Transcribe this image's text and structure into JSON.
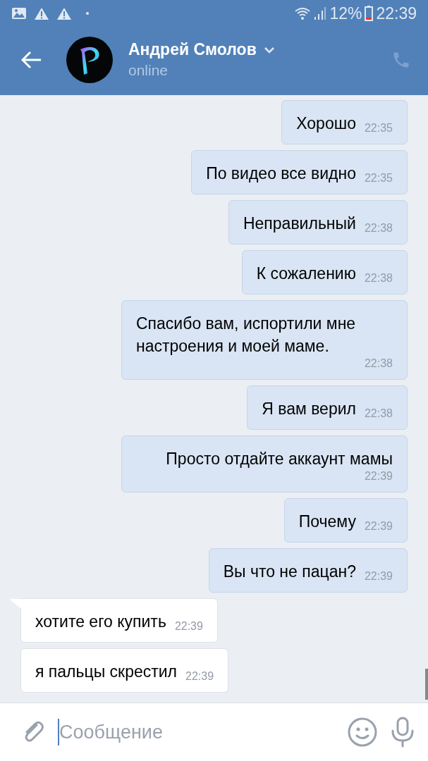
{
  "status_bar": {
    "battery": "12%",
    "time": "22:39"
  },
  "header": {
    "name": "Андрей Смолов",
    "status": "online"
  },
  "messages": [
    {
      "kind": "out",
      "text": "Хорошо",
      "time": "22:35"
    },
    {
      "kind": "out",
      "text": "По видео все видно",
      "time": "22:35"
    },
    {
      "kind": "out",
      "text": "Неправильный",
      "time": "22:38"
    },
    {
      "kind": "out",
      "text": "К сожалению",
      "time": "22:38"
    },
    {
      "kind": "out",
      "text": "Спасибо вам, испортили мне настроения и моей маме.",
      "time": "22:38"
    },
    {
      "kind": "out",
      "text": "Я вам верил",
      "time": "22:38"
    },
    {
      "kind": "out",
      "text": "Просто отдайте аккаунт мамы",
      "time": "22:39"
    },
    {
      "kind": "out",
      "text": "Почему",
      "time": "22:39"
    },
    {
      "kind": "out",
      "text": "Вы что не пацан?",
      "time": "22:39"
    },
    {
      "kind": "in",
      "text": "хотите его купить",
      "time": "22:39"
    },
    {
      "kind": "in",
      "text": "я пальцы скрестил",
      "time": "22:39"
    }
  ],
  "composer": {
    "placeholder": "Сообщение"
  }
}
